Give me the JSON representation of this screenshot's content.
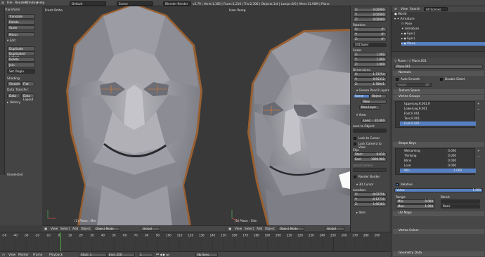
{
  "topbar": {
    "menus": [
      "File",
      "Render",
      "Window",
      "Help"
    ],
    "layout": "Default",
    "scene": "Scene",
    "engine": "Blender Render",
    "stats": "v2.79 | Verts:1,165 | Faces:1,216 | Tris:2,306 | Objects:1/4 | Lamps:0/0 | Mem:11.90M | Plane"
  },
  "toolshelf": {
    "transform_header": "Transform",
    "transform_buttons": [
      "Translate",
      "Rotate",
      "Scale",
      "Mirror"
    ],
    "edit_header": "Edit",
    "edit_buttons": [
      "Duplicate",
      "Duplicated Linked",
      "Delete",
      "Join"
    ],
    "set_origin": "Set Origin",
    "shading_label": "Shading:",
    "smooth": "Smooth",
    "flat": "Flat",
    "data_transfer_label": "Data Transfer:",
    "data": "Data",
    "data_layout": "Data Layout",
    "history": "History",
    "undetected": "Unselected"
  },
  "viewport_left": {
    "label": "Front Ortho",
    "object_name": "(1) Plane : Mirr"
  },
  "viewport_right": {
    "label": "User Persp",
    "object_name": "(1) Plane : Slim"
  },
  "viewport_header": {
    "view": "View",
    "select": "Select",
    "add": "Add",
    "object": "Object",
    "mode": "Object Mode",
    "pivot": "Global"
  },
  "npanel": {
    "loc": [
      {
        "axis": "X:",
        "value": "0.00000"
      },
      {
        "axis": "Y:",
        "value": "0.00000"
      },
      {
        "axis": "Z:",
        "value": "0.00000"
      }
    ],
    "rotation_label": "Rotation:",
    "rot": [
      {
        "axis": "X:",
        "value": "0°"
      },
      {
        "axis": "Y:",
        "value": "0°"
      },
      {
        "axis": "Z:",
        "value": "0°"
      }
    ],
    "rotation_mode": "XYZ Euler",
    "scale_label": "Scale:",
    "scale": [
      {
        "axis": "X:",
        "value": "1.000"
      },
      {
        "axis": "Y:",
        "value": "1.000"
      },
      {
        "axis": "Z:",
        "value": "1.000"
      }
    ],
    "dimensions_label": "Dimensions:",
    "dims": [
      {
        "axis": "X:",
        "value": "1.73754"
      },
      {
        "axis": "Y:",
        "value": "0.55312"
      },
      {
        "axis": "Z:",
        "value": "1.78041"
      }
    ],
    "gp_header": "Grease Pencil Layers",
    "gp_scene": "Scene",
    "gp_object": "Object",
    "gp_new": "New",
    "gp_new_layer": "New Layer",
    "view_header": "View",
    "lens_label": "Lens:",
    "lens_value": "35.000",
    "lock_to_object": "Lock to Object:",
    "lock_cursor": "Lock to Cursor",
    "lock_camera": "Lock Camera to View",
    "clip_label": "Clip:",
    "clip_start_label": "Start:",
    "clip_start": "0.010",
    "clip_end_label": "End:",
    "clip_end": "1000.000",
    "local_camera": "Local Camera",
    "render_border": "Render Border",
    "cursor_header": "3D Cursor",
    "location_label": "Location:",
    "cursor": [
      {
        "axis": "X:",
        "value": "-0.03756"
      },
      {
        "axis": "Y:",
        "value": "-0.12710"
      },
      {
        "axis": "Z:",
        "value": "1.66360"
      }
    ],
    "item_header": "Item"
  },
  "outliner": {
    "view": "View",
    "search": "Search",
    "all_scenes": "All Scenes",
    "items": [
      {
        "name": "World",
        "indent": 0
      },
      {
        "name": "Armature",
        "indent": 0
      },
      {
        "name": "Pose",
        "indent": 1
      },
      {
        "name": "Armature",
        "indent": 1
      },
      {
        "name": "Eye.L",
        "indent": 1
      },
      {
        "name": "Eye.L",
        "indent": 1
      },
      {
        "name": "Plane",
        "indent": 1
      }
    ]
  },
  "properties": {
    "breadcrumb_obj": "Plane",
    "breadcrumb_mesh": "Plane.001",
    "mesh_name": "Plane.001",
    "normals_header": "Normals",
    "auto_smooth": "Auto Smooth",
    "double_sided": "Double Sided",
    "angle_label": "Angle:",
    "angle_value": "30°",
    "texture_space": "Texture Space",
    "vertex_groups_header": "Vertex Groups",
    "vertex_groups": [
      "UpperLeg.R.001.R",
      "LowerLeg.R.001",
      "Foot.R.001",
      "Toes.R.001",
      "Foot.R.001"
    ],
    "shape_keys_header": "Shape Keys",
    "shape_keys": [
      {
        "name": "Welcoming",
        "value": "0.000"
      },
      {
        "name": "Thinking",
        "value": "0.000"
      },
      {
        "name": "Blink",
        "value": "0.000"
      },
      {
        "name": "Lose",
        "value": "0.000"
      },
      {
        "name": "Win",
        "value": "1.000"
      }
    ],
    "relative": "Relative",
    "value_label": "Value:",
    "value": "1.000",
    "range_label": "Range:",
    "range_min_label": "Min:",
    "range_min": "0.000",
    "range_max_label": "Max:",
    "range_max": "1.000",
    "blend_label": "Blend:",
    "blend_basis": "Basis",
    "uv_maps": "UV Maps",
    "vertex_colors": "Vertex Colors",
    "geometry_data": "Geometry Data"
  },
  "timeline": {
    "ticks": [
      "-50",
      "-40",
      "-30",
      "-20",
      "-10",
      "0",
      "10",
      "20",
      "30",
      "40",
      "50",
      "60",
      "70",
      "80",
      "90",
      "100",
      "110",
      "120",
      "130",
      "140",
      "150",
      "160",
      "170",
      "180",
      "190",
      "200",
      "210",
      "220",
      "230",
      "240",
      "250",
      "260",
      "270",
      "280",
      "290"
    ],
    "view": "View",
    "marker": "Marker",
    "frame": "Frame",
    "playback": "Playback",
    "start_label": "Start:",
    "start": "1",
    "end_label": "End:",
    "end": "250",
    "current": "1",
    "sync": "No Sync"
  },
  "colors": {
    "accent": "#5680c2",
    "selection": "#f0932b",
    "current_frame": "#5ab64a"
  }
}
